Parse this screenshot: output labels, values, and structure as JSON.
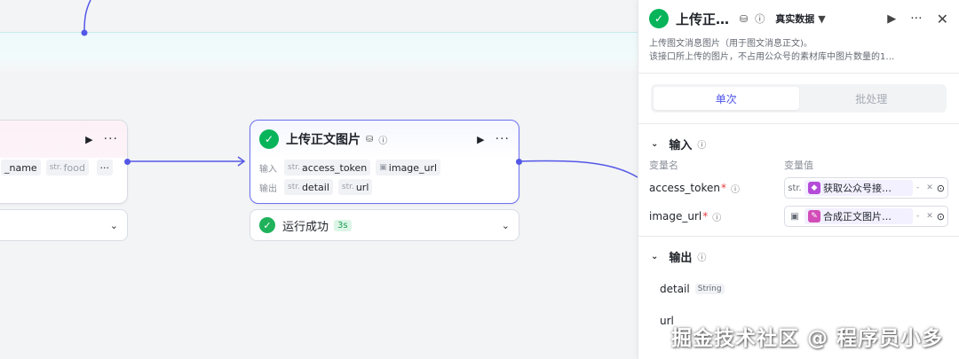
{
  "left_node": {
    "var_name": "_name",
    "var_type": "str.",
    "var_value": "food"
  },
  "main_node": {
    "title": "上传正文图片",
    "input_label": "输入",
    "output_label": "输出",
    "inputs": [
      {
        "type": "str.",
        "name": "access_token"
      },
      {
        "type": "img",
        "name": "image_url"
      }
    ],
    "outputs": [
      {
        "type": "str.",
        "name": "detail"
      },
      {
        "type": "str.",
        "name": "url"
      }
    ],
    "status_text": "运行成功",
    "duration": "3s"
  },
  "panel": {
    "title": "上传正…",
    "mode": "真实数据",
    "description_line1": "上传图文消息图片（用于图文消息正文)。",
    "description_line2": "该接口所上传的图片，不占用公众号的素材库中图片数量的1…",
    "tabs": [
      {
        "label": "单次",
        "active": true
      },
      {
        "label": "批处理",
        "active": false
      }
    ],
    "input_section": "输入",
    "col_name": "变量名",
    "col_value": "变量值",
    "inputs": [
      {
        "name": "access_token",
        "type": "str.",
        "ref": "获取公众号接…",
        "sep": "-"
      },
      {
        "name": "image_url",
        "type": "img",
        "ref": "合成正文图片…",
        "sep": "-"
      }
    ],
    "output_section": "输出",
    "outputs": [
      {
        "name": "detail",
        "type": "String"
      },
      {
        "name": "url",
        "type": ""
      }
    ]
  },
  "watermark": "掘金技术社区 @ 程序员小多"
}
